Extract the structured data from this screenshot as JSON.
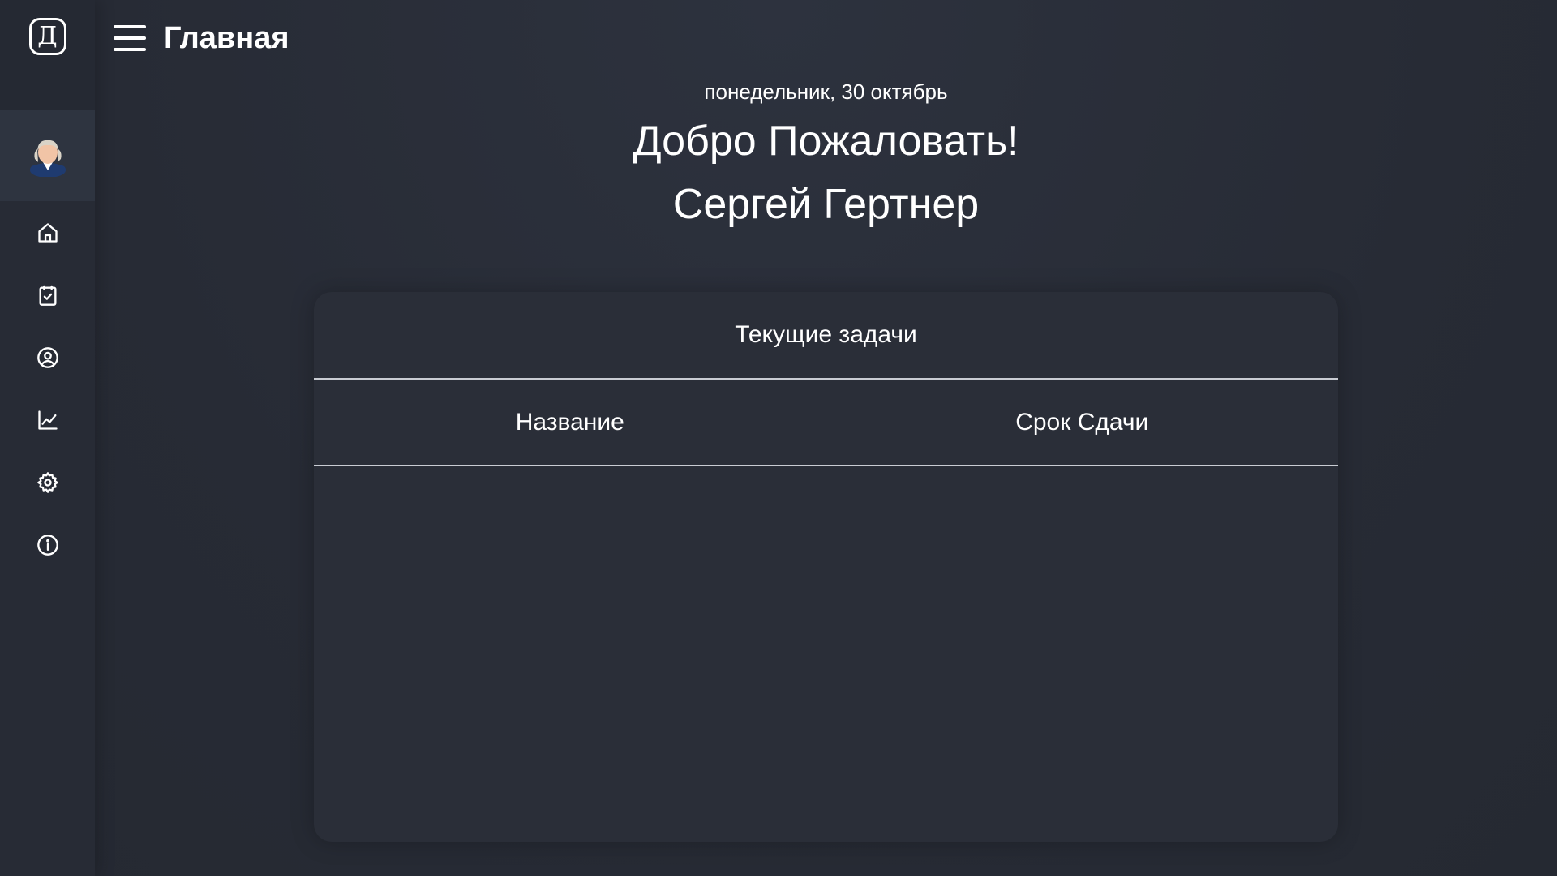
{
  "app": {
    "logo_letter": "Д"
  },
  "header": {
    "title": "Главная",
    "menu_icon": "hamburger-menu-icon"
  },
  "sidebar": {
    "avatar_icon": "user-avatar-icon",
    "items": [
      {
        "name": "home",
        "icon": "home-icon"
      },
      {
        "name": "tasks",
        "icon": "clipboard-check-icon"
      },
      {
        "name": "profile",
        "icon": "user-circle-icon"
      },
      {
        "name": "statistics",
        "icon": "chart-line-icon"
      },
      {
        "name": "settings",
        "icon": "gear-icon"
      },
      {
        "name": "info",
        "icon": "info-icon"
      }
    ]
  },
  "welcome": {
    "date": "понедельник, 30 октябрь",
    "greeting": "Добро Пожаловать!",
    "user_name": "Сергей Гертнер"
  },
  "tasks": {
    "title": "Текущие задачи",
    "columns": [
      "Название",
      "Срок Сдачи"
    ],
    "rows": []
  },
  "colors": {
    "background": "#262b36",
    "sidebar": "#272b35",
    "card": "#2a2e38",
    "divider": "#c9ccd3",
    "text": "#ffffff"
  }
}
